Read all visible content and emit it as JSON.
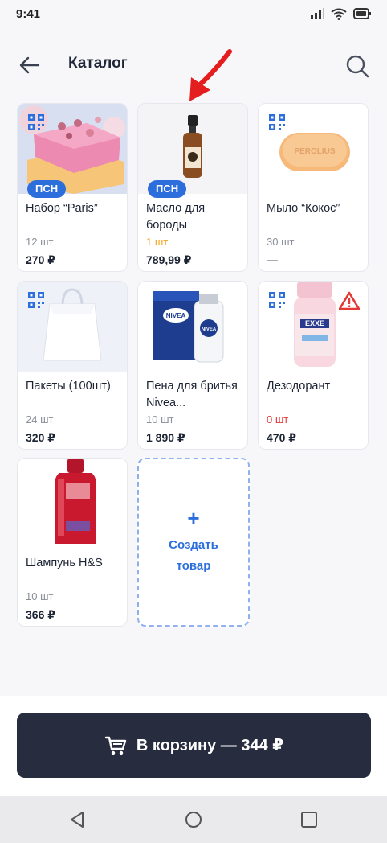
{
  "status_bar": {
    "time": "9:41"
  },
  "header": {
    "title": "Каталог"
  },
  "products": [
    {
      "name": "Набор “Paris”",
      "qty": "12 шт",
      "price": "270 ₽",
      "badge": "ПСН"
    },
    {
      "name": "Масло для бороды",
      "qty": "1 шт",
      "price": "789,99 ₽",
      "badge": "ПСН"
    },
    {
      "name": "Мыло “Кокос”",
      "qty": "30 шт",
      "price": "—",
      "image_text": "PEROLIUS"
    },
    {
      "name": "Пакеты (100шт)",
      "qty": "24 шт",
      "price": "320 ₽"
    },
    {
      "name": "Пена для бритья Nivea...",
      "qty": "10 шт",
      "price": "1 890 ₽",
      "image_text": "NIVEA"
    },
    {
      "name": "Дезодорант",
      "qty": "0 шт",
      "price": "470 ₽",
      "image_text": "EXXE"
    },
    {
      "name": "Шампунь H&S",
      "qty": "10 шт",
      "price": "366 ₽"
    }
  ],
  "create_card": {
    "plus": "+",
    "label": "Создать товар"
  },
  "cart_button": {
    "label": "В корзину — 344 ₽"
  },
  "colors": {
    "accent": "#2c6fdc",
    "dark_button": "#272c3f",
    "warning_red": "#e53935",
    "low_stock_orange": "#f3a31c",
    "annotation_arrow": "#e41e1e"
  },
  "icons": [
    "back-arrow-icon",
    "search-icon",
    "qr-icon",
    "warning-icon",
    "cart-icon",
    "nav-back-icon",
    "nav-home-icon",
    "nav-recents-icon",
    "signal-icon",
    "wifi-icon",
    "battery-icon"
  ]
}
